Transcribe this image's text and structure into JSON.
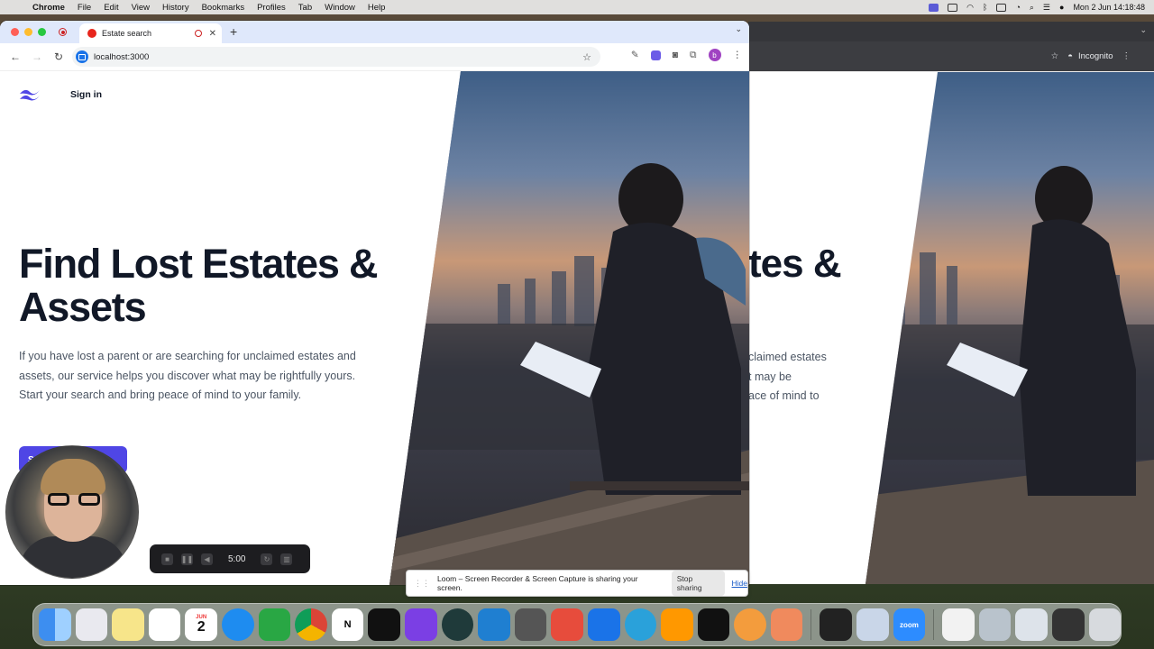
{
  "menubar": {
    "items": [
      "Chrome",
      "File",
      "Edit",
      "View",
      "History",
      "Bookmarks",
      "Profiles",
      "Tab",
      "Window",
      "Help"
    ],
    "clock": "Mon 2 Jun  14:18:48"
  },
  "browser": {
    "tab_title": "Estate search",
    "url": "localhost:3000",
    "profile_initial": "b"
  },
  "background_window": {
    "profile_label": "Incognito",
    "hero_fragment": "tes &",
    "para_lines": [
      "claimed estates",
      "t may be",
      "ace of mind to"
    ]
  },
  "page": {
    "nav_signin": "Sign in",
    "headline_line1": "Find Lost Estates &",
    "headline_line2": "Assets",
    "lead": "If you have lost a parent or are searching for unclaimed estates and assets, our service helps you discover what may be rightfully yours. Start your search and bring peace of mind to your family.",
    "cta_label": "S"
  },
  "loom": {
    "timer": "5:00",
    "share_message": "Loom – Screen Recorder & Screen Capture is sharing your screen.",
    "stop_label": "Stop sharing",
    "hide_label": "Hide"
  },
  "dock": {
    "calendar_month": "JUN",
    "calendar_day": "2",
    "zoom_label": "zoom",
    "apps": [
      "Finder",
      "Launchpad",
      "Notes",
      "Freeform",
      "Calendar",
      "Safari",
      "Numbers",
      "Chrome",
      "Notion",
      "Cursor",
      "GitHub Desktop",
      "App",
      "VS Code",
      "Calculator",
      "App",
      "Reader",
      "Telegram",
      "Sublime Text",
      "Figma",
      "App",
      "App",
      "Logic",
      "Preview",
      "Zoom",
      "File",
      "Image",
      "Image",
      "Terminal",
      "Trash"
    ]
  },
  "colors": {
    "accent": "#4f46e5",
    "heading": "#111827",
    "body_text": "#4b5563",
    "tab_strip": "#dfe8fb"
  }
}
